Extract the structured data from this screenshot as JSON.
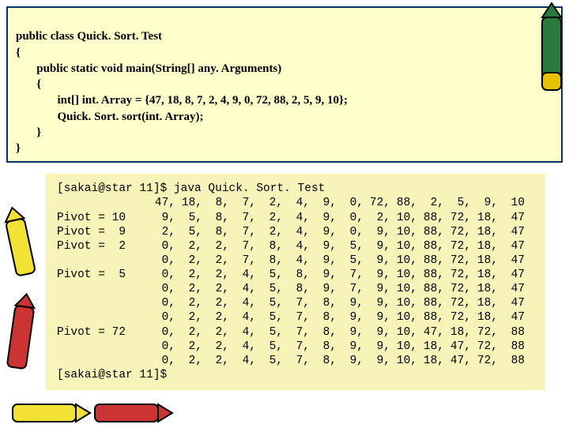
{
  "code": {
    "line1": "public class Quick. Sort. Test",
    "line2": "{",
    "line3": "       public static void main(String[] any. Arguments)",
    "line4": "       {",
    "line5": "              int[] int. Array = {47, 18, 8, 7, 2, 4, 9, 0, 72, 88, 2, 5, 9, 10};",
    "line6": "              Quick. Sort. sort(int. Array);",
    "line7": "       }",
    "line8": "}"
  },
  "term": {
    "prompt_start": "[sakai@star 11]$ java Quick. Sort. Test",
    "prompt_end": "[sakai@star 11]$",
    "rows": [
      {
        "label": "",
        "vals": [
          "47,",
          "18,",
          "8,",
          "7,",
          "2,",
          "4,",
          "9,",
          "0,",
          "72,",
          "88,",
          "2,",
          "5,",
          "9,",
          "10"
        ]
      },
      {
        "label": "Pivot = 10",
        "vals": [
          "9,",
          "5,",
          "8,",
          "7,",
          "2,",
          "4,",
          "9,",
          "0,",
          "2,",
          "10,",
          "88,",
          "72,",
          "18,",
          "47"
        ]
      },
      {
        "label": "Pivot =  9",
        "vals": [
          "2,",
          "5,",
          "8,",
          "7,",
          "2,",
          "4,",
          "9,",
          "0,",
          "9,",
          "10,",
          "88,",
          "72,",
          "18,",
          "47"
        ]
      },
      {
        "label": "Pivot =  2",
        "vals": [
          "0,",
          "2,",
          "2,",
          "7,",
          "8,",
          "4,",
          "9,",
          "5,",
          "9,",
          "10,",
          "88,",
          "72,",
          "18,",
          "47"
        ]
      },
      {
        "label": "",
        "vals": [
          "0,",
          "2,",
          "2,",
          "7,",
          "8,",
          "4,",
          "9,",
          "5,",
          "9,",
          "10,",
          "88,",
          "72,",
          "18,",
          "47"
        ]
      },
      {
        "label": "Pivot =  5",
        "vals": [
          "0,",
          "2,",
          "2,",
          "4,",
          "5,",
          "8,",
          "9,",
          "7,",
          "9,",
          "10,",
          "88,",
          "72,",
          "18,",
          "47"
        ]
      },
      {
        "label": "",
        "vals": [
          "0,",
          "2,",
          "2,",
          "4,",
          "5,",
          "8,",
          "9,",
          "7,",
          "9,",
          "10,",
          "88,",
          "72,",
          "18,",
          "47"
        ]
      },
      {
        "label": "",
        "vals": [
          "0,",
          "2,",
          "2,",
          "4,",
          "5,",
          "7,",
          "8,",
          "9,",
          "9,",
          "10,",
          "88,",
          "72,",
          "18,",
          "47"
        ]
      },
      {
        "label": "",
        "vals": [
          "0,",
          "2,",
          "2,",
          "4,",
          "5,",
          "7,",
          "8,",
          "9,",
          "9,",
          "10,",
          "88,",
          "72,",
          "18,",
          "47"
        ]
      },
      {
        "label": "Pivot = 72",
        "vals": [
          "0,",
          "2,",
          "2,",
          "4,",
          "5,",
          "7,",
          "8,",
          "9,",
          "9,",
          "10,",
          "47,",
          "18,",
          "72,",
          "88"
        ]
      },
      {
        "label": "",
        "vals": [
          "0,",
          "2,",
          "2,",
          "4,",
          "5,",
          "7,",
          "8,",
          "9,",
          "9,",
          "10,",
          "18,",
          "47,",
          "72,",
          "88"
        ]
      },
      {
        "label": "",
        "vals": [
          "0,",
          "2,",
          "2,",
          "4,",
          "5,",
          "7,",
          "8,",
          "9,",
          "9,",
          "10,",
          "18,",
          "47,",
          "72,",
          "88"
        ]
      }
    ]
  }
}
